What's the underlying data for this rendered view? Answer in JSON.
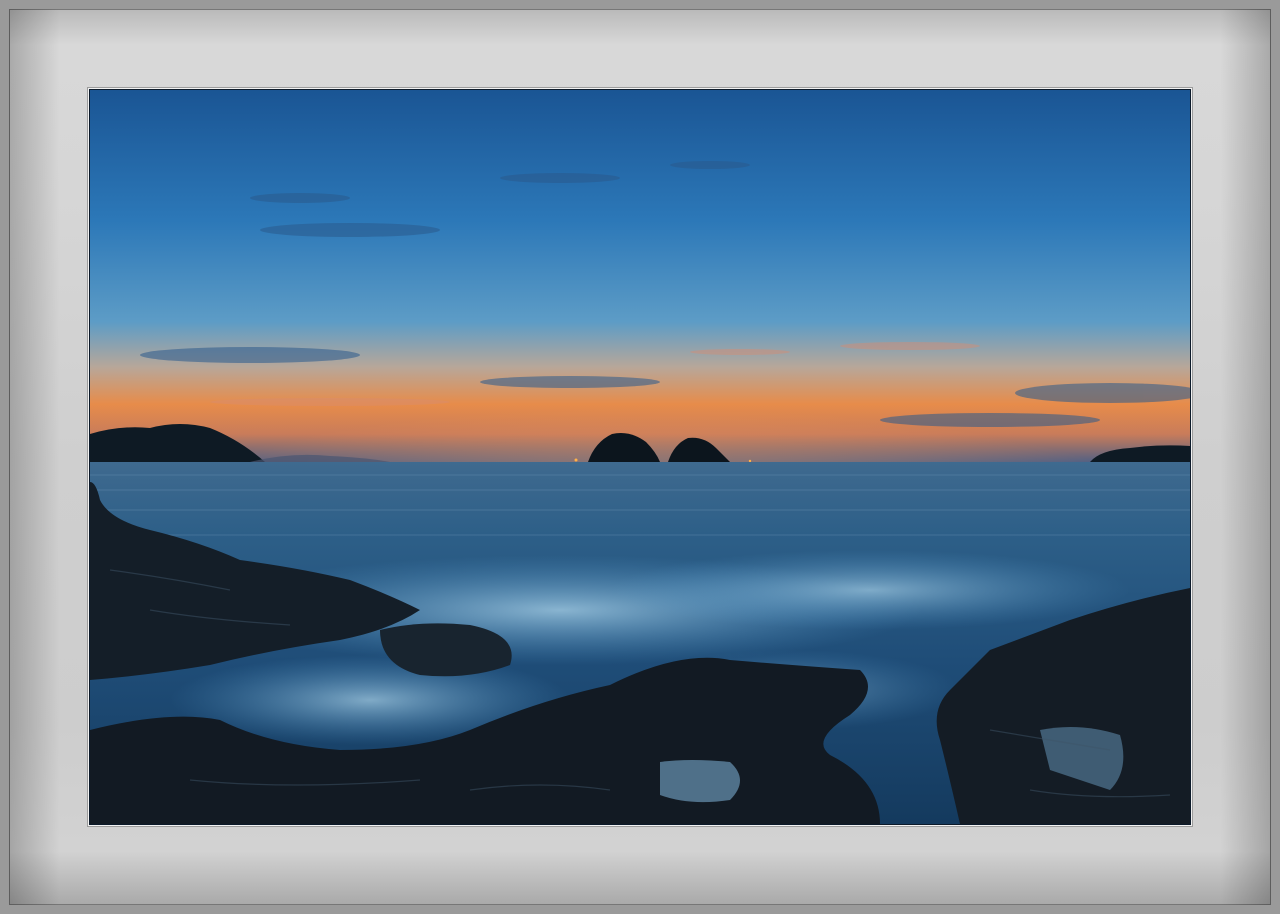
{
  "image": {
    "subject": "seascape-at-twilight",
    "colors": {
      "sky_top": "#1f5f9e",
      "sky_mid": "#3e8bc4",
      "horizon_glow": "#f08a3c",
      "horizon_band": "#e9b07a",
      "sea": "#2a5a84",
      "foam": "#8cc6e8",
      "rock": "#16202b",
      "mat": "#d4d4d4",
      "frame": "#8a8a8a"
    }
  }
}
